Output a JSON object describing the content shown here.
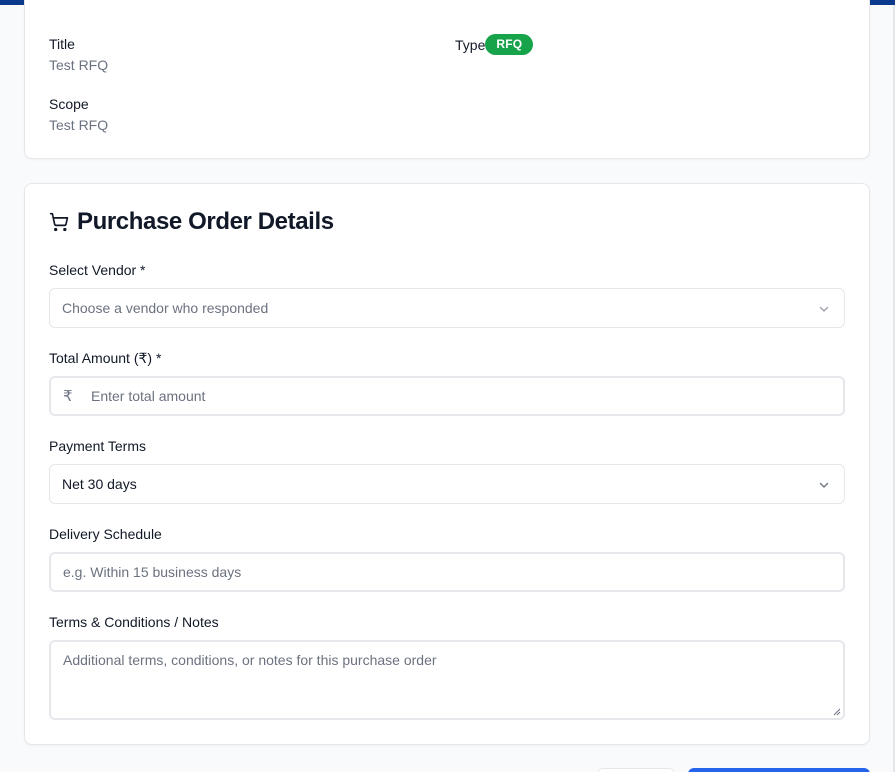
{
  "summary": {
    "title_label": "Title",
    "title_value": "Test RFQ",
    "scope_label": "Scope",
    "scope_value": "Test RFQ",
    "type_label": "Type",
    "type_badge": "RFQ"
  },
  "purchase_order": {
    "section_icon": "cart-icon",
    "section_title": "Purchase Order Details",
    "vendor": {
      "label": "Select Vendor *",
      "placeholder": "Choose a vendor who responded"
    },
    "amount": {
      "label": "Total Amount (₹) *",
      "currency_symbol": "₹",
      "placeholder": "Enter total amount"
    },
    "payment_terms": {
      "label": "Payment Terms",
      "selected": "Net 30 days"
    },
    "delivery": {
      "label": "Delivery Schedule",
      "placeholder": "e.g. Within 15 business days"
    },
    "notes": {
      "label": "Terms & Conditions / Notes",
      "placeholder": "Additional terms, conditions, or notes for this purchase order"
    }
  },
  "colors": {
    "accent_bar": "#0b3a8c",
    "badge_green": "#16a34a",
    "primary_button": "#2563eb"
  }
}
